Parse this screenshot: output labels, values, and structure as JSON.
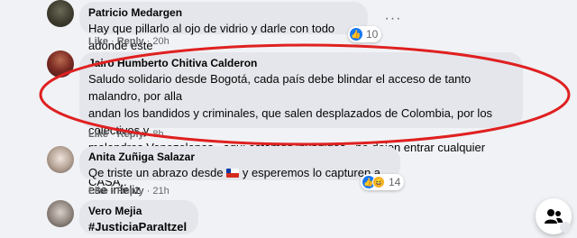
{
  "comments": [
    {
      "author": "Patricio Medargen",
      "text": "Hay que pillarlo al ojo de vidrio y darle con todo adonde este",
      "like": "Like",
      "reply": "Reply",
      "time": "20h",
      "reaction_count": "10"
    },
    {
      "author": "Jairo Humberto Chitiva Calderon",
      "lines": [
        "Saludo solidario desde Bogotá, cada país debe blindar el acceso de tanto malandro, por alla",
        "andan los bandidos y criminales, que salen desplazados de Colombia, por los colectivos y",
        "malandros Venezolanos.. aqui estamos invadidos.. no dejen entrar cualquier psicópata en su",
        "CASA.."
      ],
      "like": "Like",
      "reply": "Reply",
      "time": "8h"
    },
    {
      "author": "Anita Zuñiga Salazar",
      "text_before": "Qe triste un abrazo desde",
      "text_after": "y esperemos lo capturen a ese infeliz",
      "like": "Like",
      "reply": "Reply",
      "time": "21h",
      "reaction_count": "14"
    },
    {
      "author": "Vero Mejia",
      "text": "#JusticiaParaItzel"
    }
  ],
  "colors": {
    "highlight_ellipse": "#e02020",
    "like_blue": "#1877f2",
    "bubble_bg": "#e4e6eb"
  },
  "icons": [
    "more-options-icon",
    "like-reaction-icon",
    "haha-reaction-icon",
    "chile-flag-icon",
    "people-icon"
  ]
}
